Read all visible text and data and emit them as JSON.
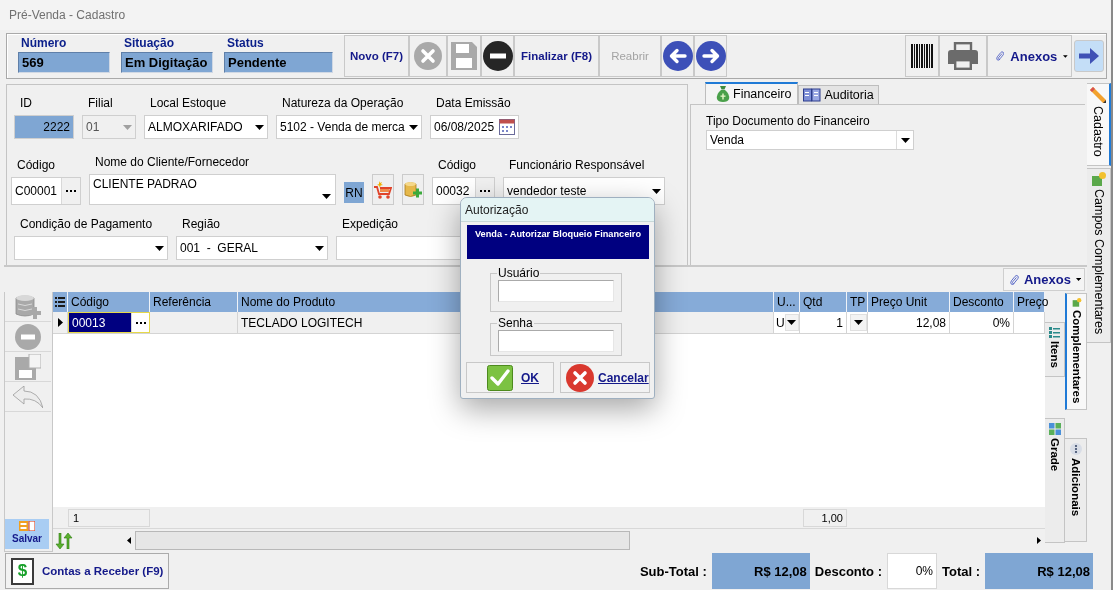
{
  "window": {
    "title": "Pré-Venda - Cadastro"
  },
  "header_fields": [
    {
      "label": "Número",
      "value": "569"
    },
    {
      "label": "Situação",
      "value": "Em Digitação"
    },
    {
      "label": "Status",
      "value": "Pendente"
    }
  ],
  "toolbar": {
    "buttons": [
      {
        "kind": "text",
        "label": "Novo (F7)",
        "disabled": false
      },
      {
        "kind": "cancel",
        "disabled": true
      },
      {
        "kind": "save",
        "disabled": true
      },
      {
        "kind": "remove",
        "disabled": false
      },
      {
        "kind": "text",
        "label": "Finalizar (F8)",
        "disabled": false
      },
      {
        "kind": "text",
        "label": "Reabrir",
        "disabled": true
      },
      {
        "kind": "previous",
        "disabled": false
      },
      {
        "kind": "next",
        "disabled": false
      }
    ],
    "right_buttons": [
      {
        "kind": "barcode"
      },
      {
        "kind": "print"
      },
      {
        "kind": "menu",
        "label": "Anexos"
      },
      {
        "kind": "forward"
      }
    ]
  },
  "form": {
    "lines": [
      {
        "fields": [
          {
            "kind": "readonly",
            "label": "ID",
            "value": "2222"
          },
          {
            "kind": "dropdown",
            "label": "Filial",
            "value": "01",
            "disabled": true
          },
          {
            "kind": "dropdown",
            "label": "Local Estoque",
            "value": "ALMOXARIFADO",
            "disabled": false
          },
          {
            "kind": "dropdown",
            "label": "Natureza da Operação",
            "value": "5102 - Venda de merca",
            "disabled": false
          },
          {
            "kind": "date",
            "label": "Data Emissão",
            "value": "06/08/2025"
          }
        ]
      },
      {
        "fields": [
          {
            "kind": "lookup",
            "label": "Código",
            "value": "C00001"
          },
          {
            "kind": "memo",
            "label": "Nome do Cliente/Fornecedor",
            "value": "CLIENTE PADRAO"
          },
          {
            "kind": "badge",
            "value": "RN"
          },
          {
            "kind": "cart"
          },
          {
            "kind": "add"
          },
          {
            "kind": "lookup",
            "label": "Código",
            "value": "00032"
          },
          {
            "kind": "dropdown",
            "label": "Funcionário Responsável",
            "value": "vendedor teste",
            "disabled": false
          }
        ]
      },
      {
        "fields": [
          {
            "kind": "dropdown",
            "label": "Condição de Pagamento",
            "disabled": false
          },
          {
            "kind": "dropdown",
            "label": "Região",
            "value": "001  -  GERAL",
            "disabled": false
          },
          {
            "kind": "text",
            "label": "Expedição"
          }
        ]
      }
    ]
  },
  "finance": {
    "tabs": [
      {
        "label": "Financeiro",
        "selected": true
      },
      {
        "label": "Auditoria",
        "selected": false
      }
    ],
    "field": {
      "label": "Tipo Documento do Financeiro",
      "value": "Venda"
    }
  },
  "side_tabs": [
    {
      "label": "Cadastro",
      "selected": true
    },
    {
      "label": "Campos Complementares",
      "selected": false
    }
  ],
  "attachments": {
    "label": "Anexos"
  },
  "grid": {
    "tools": [
      {
        "kind": "add",
        "disabled": true
      },
      {
        "kind": "remove",
        "disabled": true
      },
      {
        "kind": "save",
        "disabled": true
      },
      {
        "kind": "undo",
        "disabled": true
      }
    ],
    "save_button": {
      "label": "Salvar"
    },
    "columns": [
      "Código",
      "Referência",
      "Nome do Produto",
      "U...",
      "Qtd",
      "TP",
      "Preço Unit",
      "Desconto",
      "Preço"
    ],
    "rows": [
      {
        "selected": true,
        "code": "00013",
        "product": "TECLADO LOGITECH",
        "unit": "U",
        "qty": "1",
        "unit_price": "12,08",
        "discount": "0%"
      }
    ],
    "footer": {
      "count": "1",
      "qty_total": "1,00"
    }
  },
  "grid_tabs": {
    "inner": [
      {
        "label": "Itens",
        "selected": false
      },
      {
        "label": "Grade",
        "selected": false
      }
    ],
    "outer": [
      {
        "label": "Complementares",
        "selected": true
      },
      {
        "label": "Adicionais",
        "selected": false
      }
    ]
  },
  "bottom": {
    "receivables_button": {
      "icon": "$",
      "label": "Contas a Receber (F9)"
    },
    "totals": [
      {
        "kind": "value",
        "label": "Sub-Total :",
        "value": "R$ 12,08"
      },
      {
        "kind": "input",
        "label": "Desconto :",
        "value": "0%"
      },
      {
        "kind": "value",
        "label": "Total :",
        "value": "R$ 12,08"
      }
    ]
  },
  "dialog": {
    "title": "Autorização",
    "banner": "Venda - Autorizar Bloqueio Financeiro",
    "fields": [
      {
        "label": "Usuário"
      },
      {
        "label": "Senha"
      }
    ],
    "buttons": [
      {
        "kind": "ok",
        "label": "OK"
      },
      {
        "kind": "cancel",
        "label": "Cancelar"
      }
    ]
  }
}
